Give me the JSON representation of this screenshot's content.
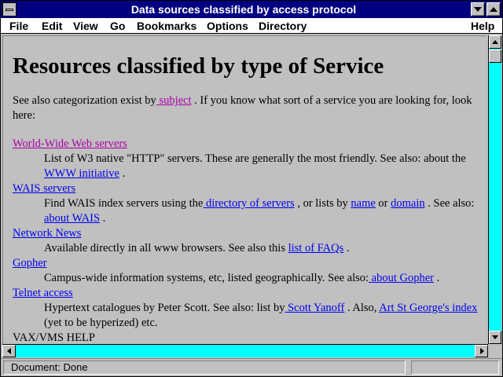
{
  "window": {
    "title": "Data sources classified by access protocol"
  },
  "menubar": {
    "items": [
      "File",
      "Edit",
      "View",
      "Go",
      "Bookmarks",
      "Options",
      "Directory",
      "Help"
    ]
  },
  "page": {
    "heading": "Resources classified by type of Service",
    "intro_before": "See also categorization exist by",
    "intro_link": " subject",
    "intro_after": " . If you know what sort of a service you are looking for, look here:",
    "entries": [
      {
        "term": "World-Wide Web servers",
        "desc_1": "List of W3 native \"HTTP\" servers. These are generally the most friendly. See also: about the ",
        "link_1": "WWW initiative",
        "desc_2": " ."
      },
      {
        "term": "WAIS servers",
        "desc_1": "Find WAIS index servers using the",
        "link_1": " directory of servers",
        "desc_2": " , or lists by ",
        "link_2": "name",
        "desc_3": " or ",
        "link_3": "domain",
        "desc_4": " . See also: ",
        "link_4": "about WAIS",
        "desc_5": " ."
      },
      {
        "term": "Network News",
        "desc_1": "Available directly in all www browsers. See also this ",
        "link_1": "list of FAQs",
        "desc_2": " ."
      },
      {
        "term": "Gopher",
        "desc_1": "Campus-wide information systems, etc, listed geographically. See also:",
        "link_1": " about Gopher",
        "desc_2": " ."
      },
      {
        "term": "Telnet access",
        "desc_1": "Hypertext catalogues by Peter Scott. See also: list by",
        "link_1": " Scott Yanoff",
        "desc_2": " . Also, ",
        "link_2": "Art St George's index",
        "desc_3": " (yet to be hyperized) etc."
      }
    ],
    "cutoff_line": "VAX/VMS HELP"
  },
  "status": {
    "text": "Document: Done"
  },
  "colors": {
    "titlebar": "#000080",
    "link": "#0000ee",
    "visited_link": "#aa00aa",
    "scroll_track": "#00ffff",
    "chrome": "#c0c0c0"
  }
}
